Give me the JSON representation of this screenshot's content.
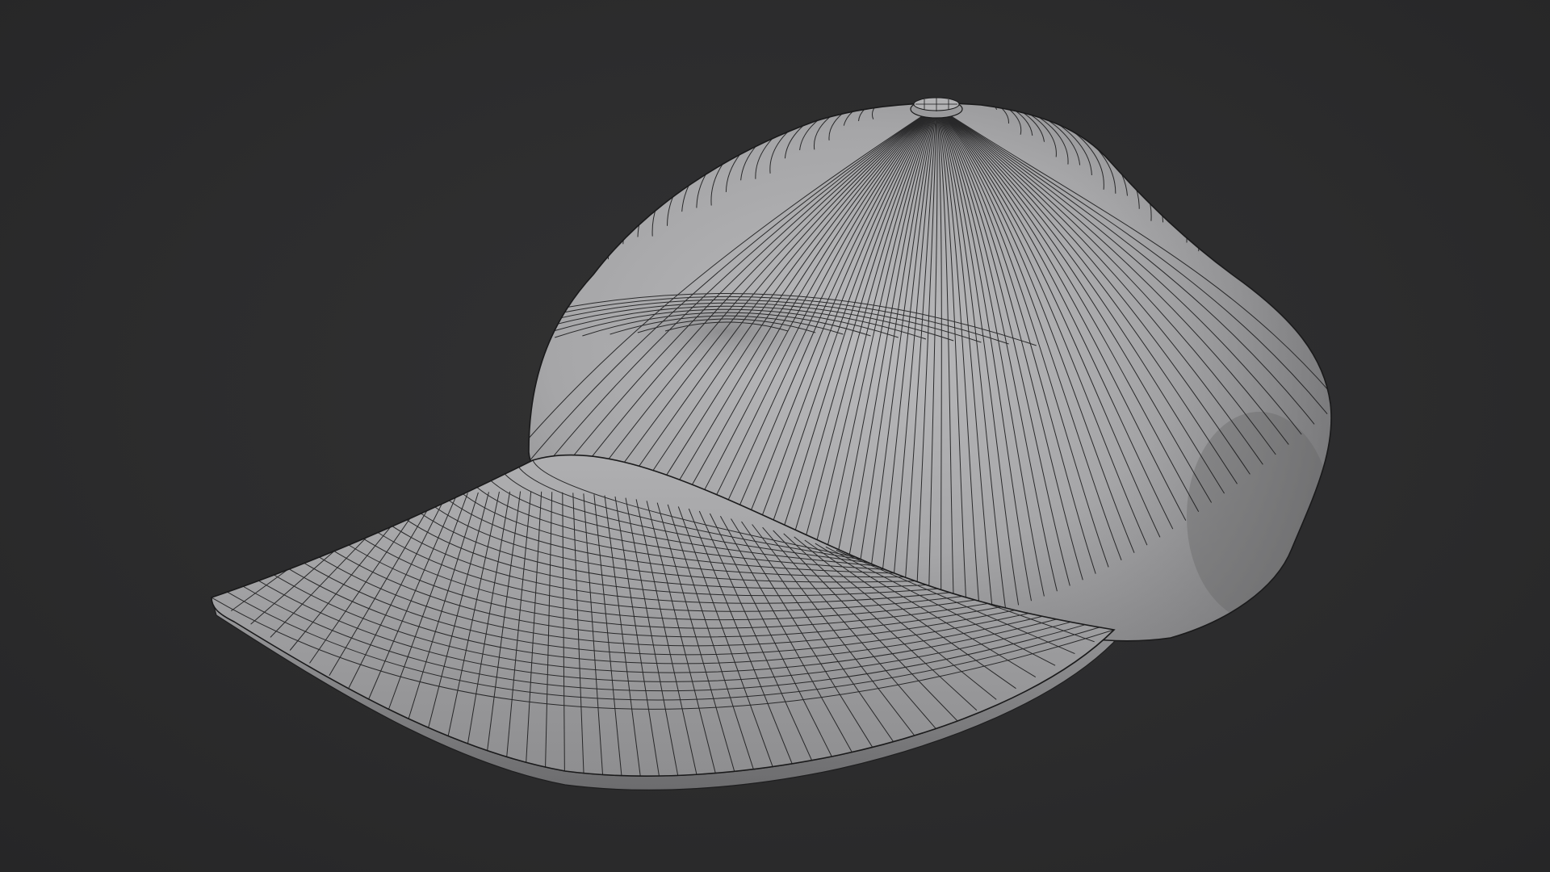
{
  "scene": {
    "object": "cap-wireframe",
    "colors": {
      "background": "#2b2b2c",
      "surface": "#a9a9ab",
      "surface_dark": "#6e6e70",
      "wire": "#1b1b1c"
    },
    "display_mode": "solid-with-wireframe-overlay"
  }
}
